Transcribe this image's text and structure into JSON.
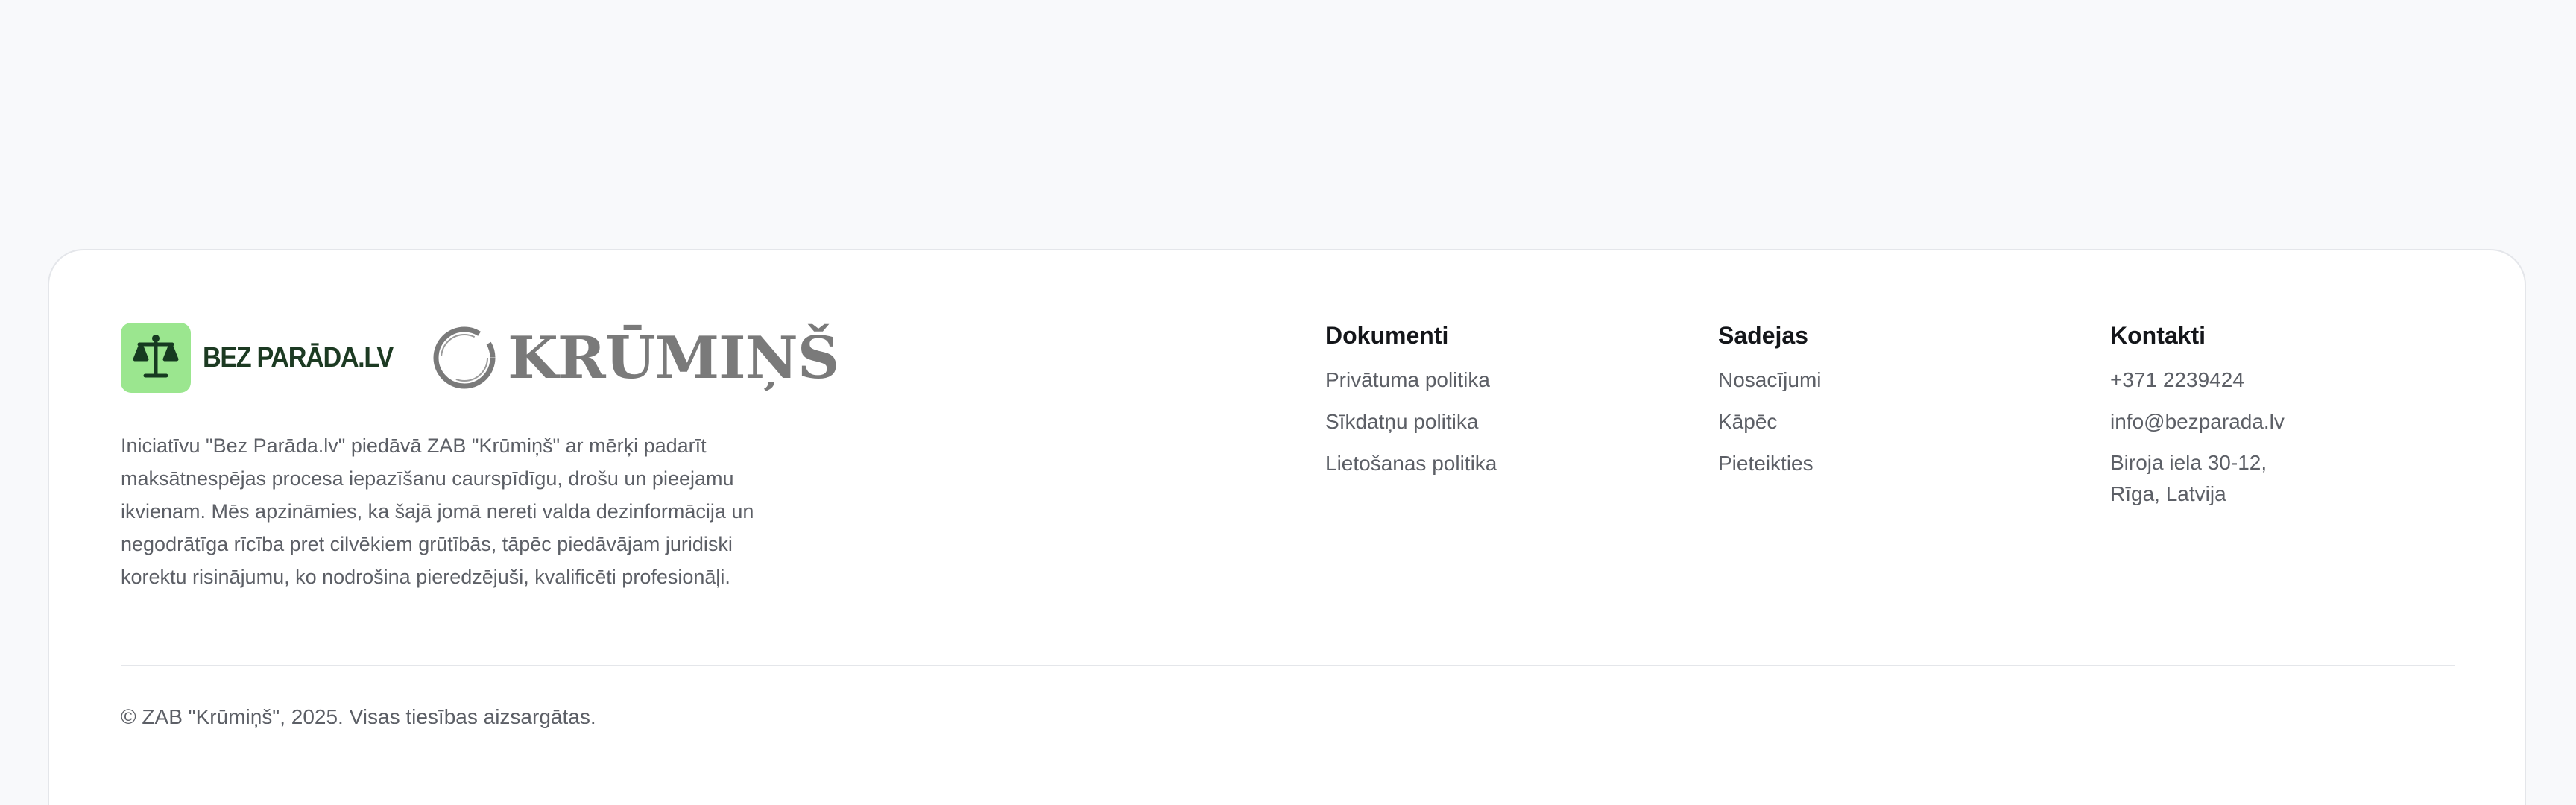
{
  "brand": {
    "bez_parada_label": "BEZ PARĀDA.LV",
    "krumins_label": "KRŪMIŅŠ",
    "accent_green": "#9be68f",
    "dark_green": "#1c3a22",
    "logo_icons": [
      "scales-icon",
      "ring-icon"
    ]
  },
  "description": "Iniciatīvu \"Bez Parāda.lv\" piedāvā ZAB \"Krūmiņš\" ar mērķi padarīt maksātnespējas procesa iepazīšanu caurspīdīgu, drošu un pieejamu ikvienam. Mēs apzināmies, ka šajā jomā nereti valda dezinformācija un negodrātīga rīcība pret cilvēkiem grūtībās, tāpēc piedāvājam juridiski korektu risinājumu, ko nodrošina pieredzējuši, kvalificēti profesionāļi.",
  "columns": {
    "documents": {
      "title": "Dokumenti",
      "items": [
        "Privātuma politika",
        "Sīkdatņu politika",
        "Lietošanas politika"
      ]
    },
    "links": {
      "title": "Sadejas",
      "items": [
        "Nosacījumi",
        "Kāpēc",
        "Pieteikties"
      ]
    },
    "contacts": {
      "title": "Kontakti",
      "phone": "+371 2239424",
      "email": "info@bezparada.lv",
      "address": "Biroja iela 30-12,\nRīga, Latvija"
    }
  },
  "copyright": "© ZAB \"Krūmiņš\", 2025. Visas tiesības aizsargātas."
}
